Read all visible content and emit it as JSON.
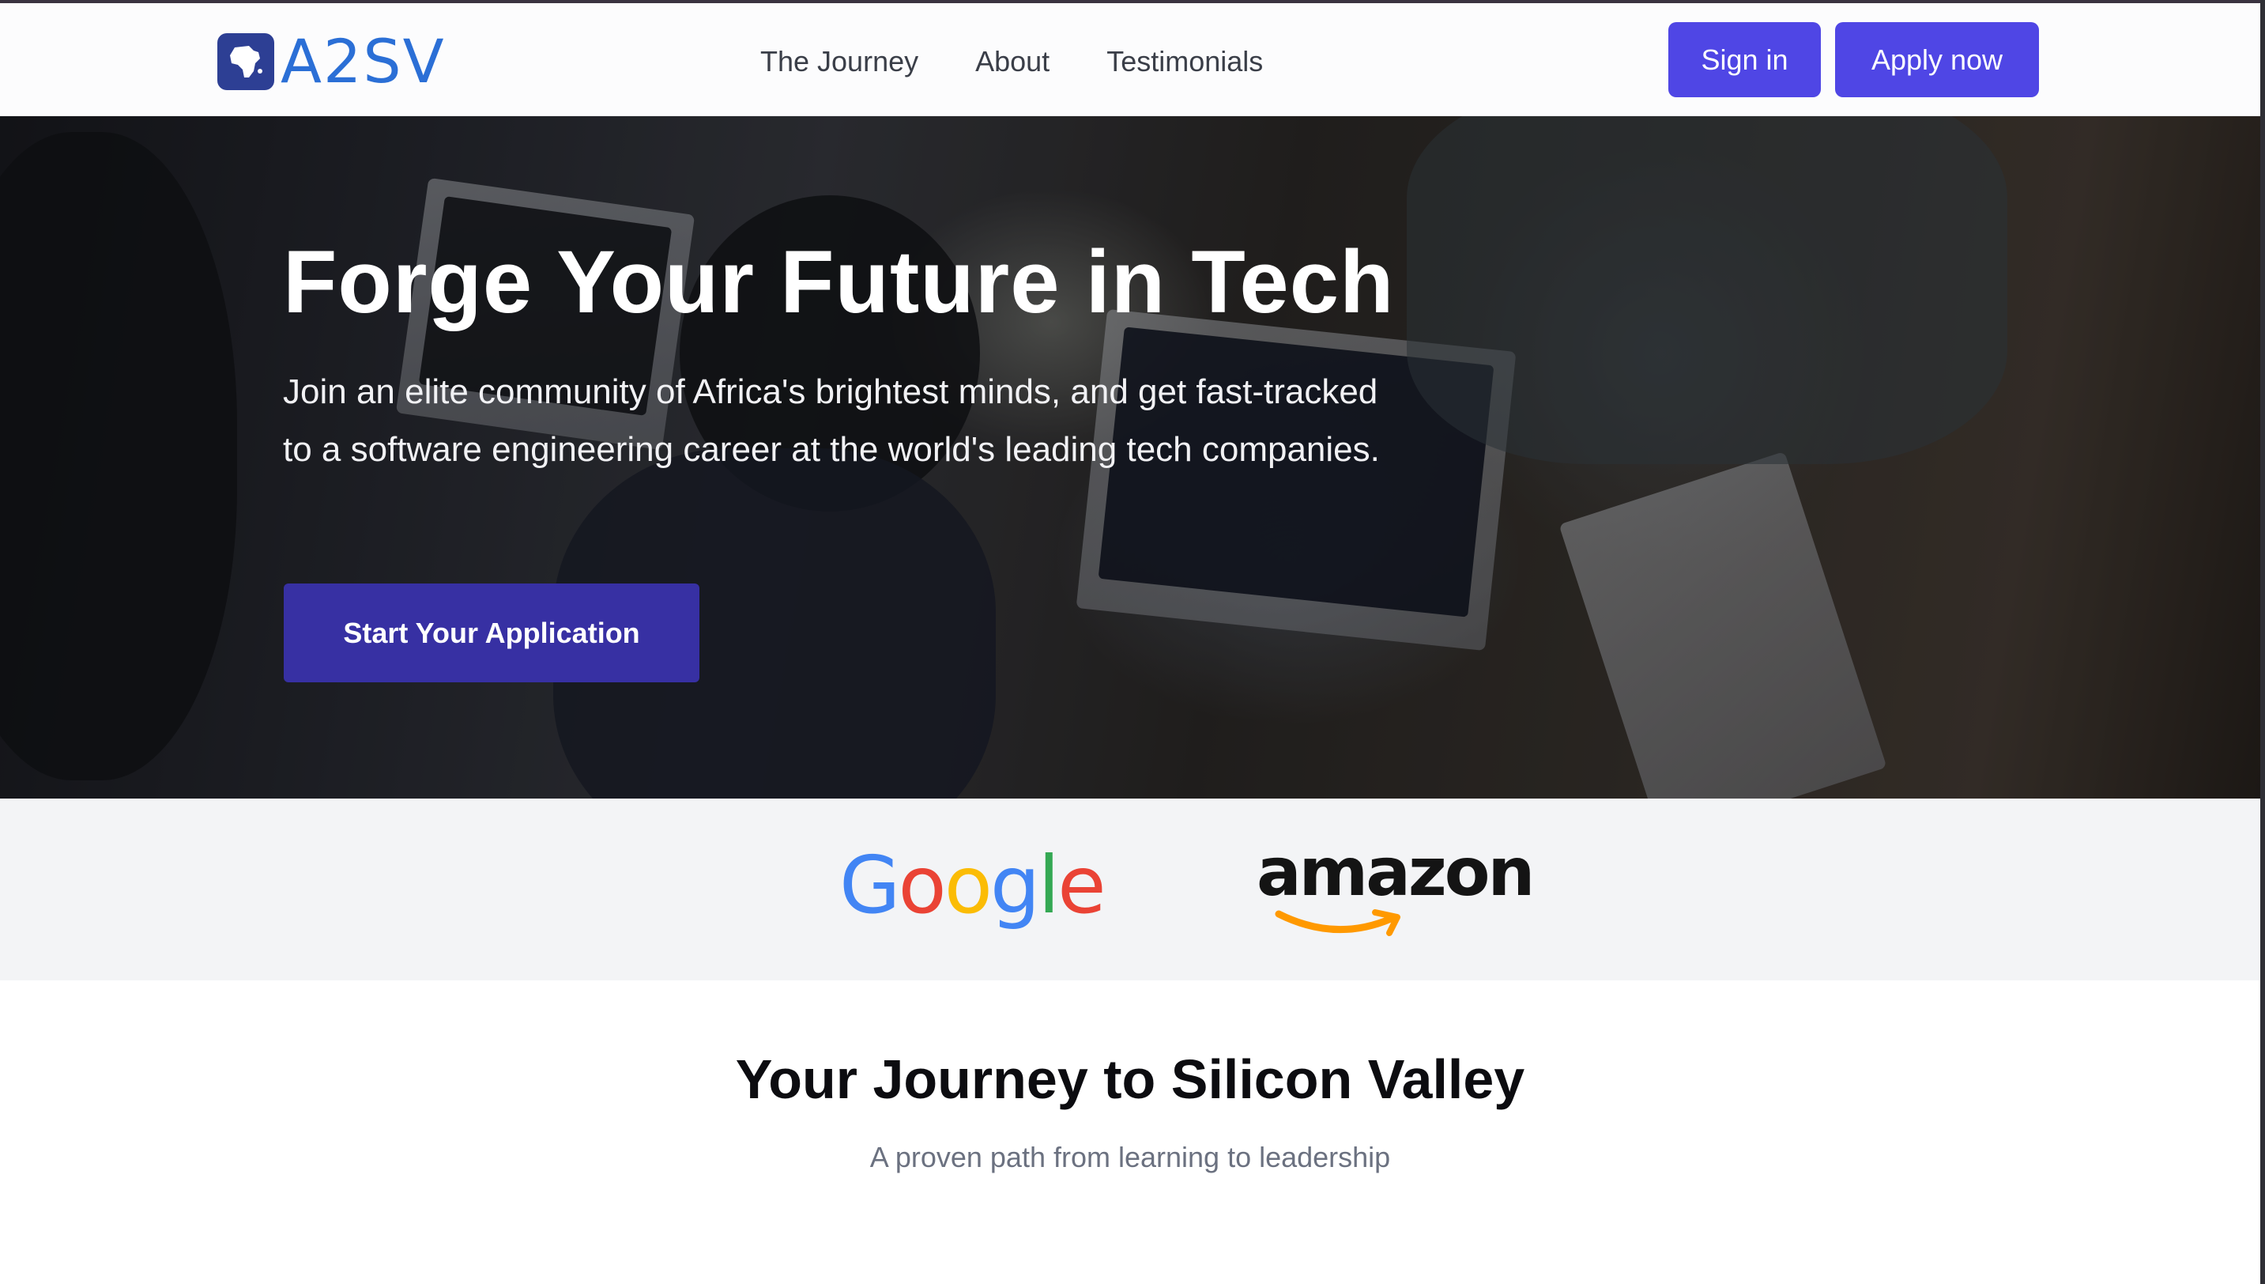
{
  "header": {
    "logo_text": "A2SV",
    "nav": [
      {
        "label": "The Journey"
      },
      {
        "label": "About"
      },
      {
        "label": "Testimonials"
      }
    ],
    "sign_in_label": "Sign in",
    "apply_label": "Apply now"
  },
  "hero": {
    "title": "Forge Your Future in Tech",
    "subtitle": "Join an elite community of Africa's brightest minds, and get fast-tracked to a software engineering career at the world's leading tech companies.",
    "cta_label": "Start Your Application"
  },
  "partners": {
    "google": "Google",
    "amazon": "amazon"
  },
  "journey": {
    "title": "Your Journey to Silicon Valley",
    "subtitle": "A proven path from learning to leadership"
  },
  "colors": {
    "accent": "#4f46e5",
    "cta": "#3730a3",
    "logo": "#2b6fd6"
  }
}
